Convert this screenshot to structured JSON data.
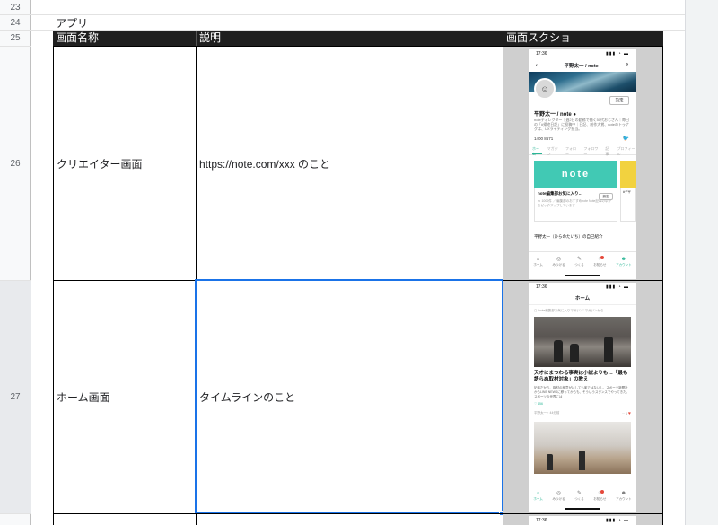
{
  "sheet": {
    "row_numbers": [
      "23",
      "24",
      "25",
      "26",
      "27"
    ],
    "section_label": "アプリ",
    "headers": [
      "画面名称",
      "説明",
      "画面スクショ"
    ],
    "rows": [
      {
        "name": "クリエイター画面",
        "description": "https://note.com/xxx のこと"
      },
      {
        "name": "ホーム画面",
        "description": "タイムラインのこと"
      }
    ]
  },
  "phone_creator": {
    "time": "17:36",
    "signal": "▮▮▮ ◔ ▬",
    "nav_title": "平野太一 / note",
    "back": "‹",
    "share": "⇪",
    "avatar_glyph": "☺",
    "settings_button": "設定",
    "profile_name": "平野太一 / note ●",
    "bio": "noteディレクター｜週2日の勤務で働く50代おじさん｜毎日の「#帰宅日記」に投稿中｜日記、創作大賞、noteのトゥナグは、UXライティング担当。",
    "stats": "1400  8671",
    "twitter_icon": "🐦",
    "tabs": [
      "ホーム",
      "マガジン",
      "フォロー",
      "フォロワー",
      "記事",
      "プロフィール"
    ],
    "banner_text": "note",
    "card_title": "note編集部お気に入り…",
    "card_sub": "ｎ 1000件 ／ 編集部のおすすめnote Note記事の中からピックアップしています",
    "card_button": "設定",
    "card2_text": "#デザ",
    "footer_text": "平野太一（ひらのたいち）の自己紹介",
    "tabbar": [
      {
        "icon": "⌂",
        "label": "ホーム"
      },
      {
        "icon": "◎",
        "label": "みつける"
      },
      {
        "icon": "✎",
        "label": "つくる"
      },
      {
        "icon": "♢",
        "label": "お知らせ"
      },
      {
        "icon": "☻",
        "label": "アカウント"
      }
    ],
    "colors": {
      "accent": "#2cb696",
      "banner": "#41c9b4",
      "badge": "#e5483a"
    }
  },
  "phone_home": {
    "time": "17:36",
    "signal": "▮▮▮ ◔ ▬",
    "title": "ホーム",
    "sub": "▢ \"note編集部お気に入りマガジン\" マガジンから",
    "headline": "天才にまつわる事実は小説よりも…「最も語らぬ取材対象」の教え",
    "body": "記者だから、取材の極意がはしても楽ではないし、スポーツ新聞社からLINE NEWSに移ってからも、そういうスタンスでやってきた。スポーツの世界には",
    "likes": "♡ 456",
    "meta_left": "平野太一・44分前",
    "meta_icons": "⋯  ⌸",
    "heart": "♥",
    "tabbar": [
      {
        "icon": "⌂",
        "label": "ホーム"
      },
      {
        "icon": "◎",
        "label": "みつける"
      },
      {
        "icon": "✎",
        "label": "つくる"
      },
      {
        "icon": "♢",
        "label": "お知らせ"
      },
      {
        "icon": "☻",
        "label": "アカウント"
      }
    ]
  },
  "phone_partial": {
    "time": "17:36",
    "signal": "▮▮▮ ◔ ▬"
  }
}
